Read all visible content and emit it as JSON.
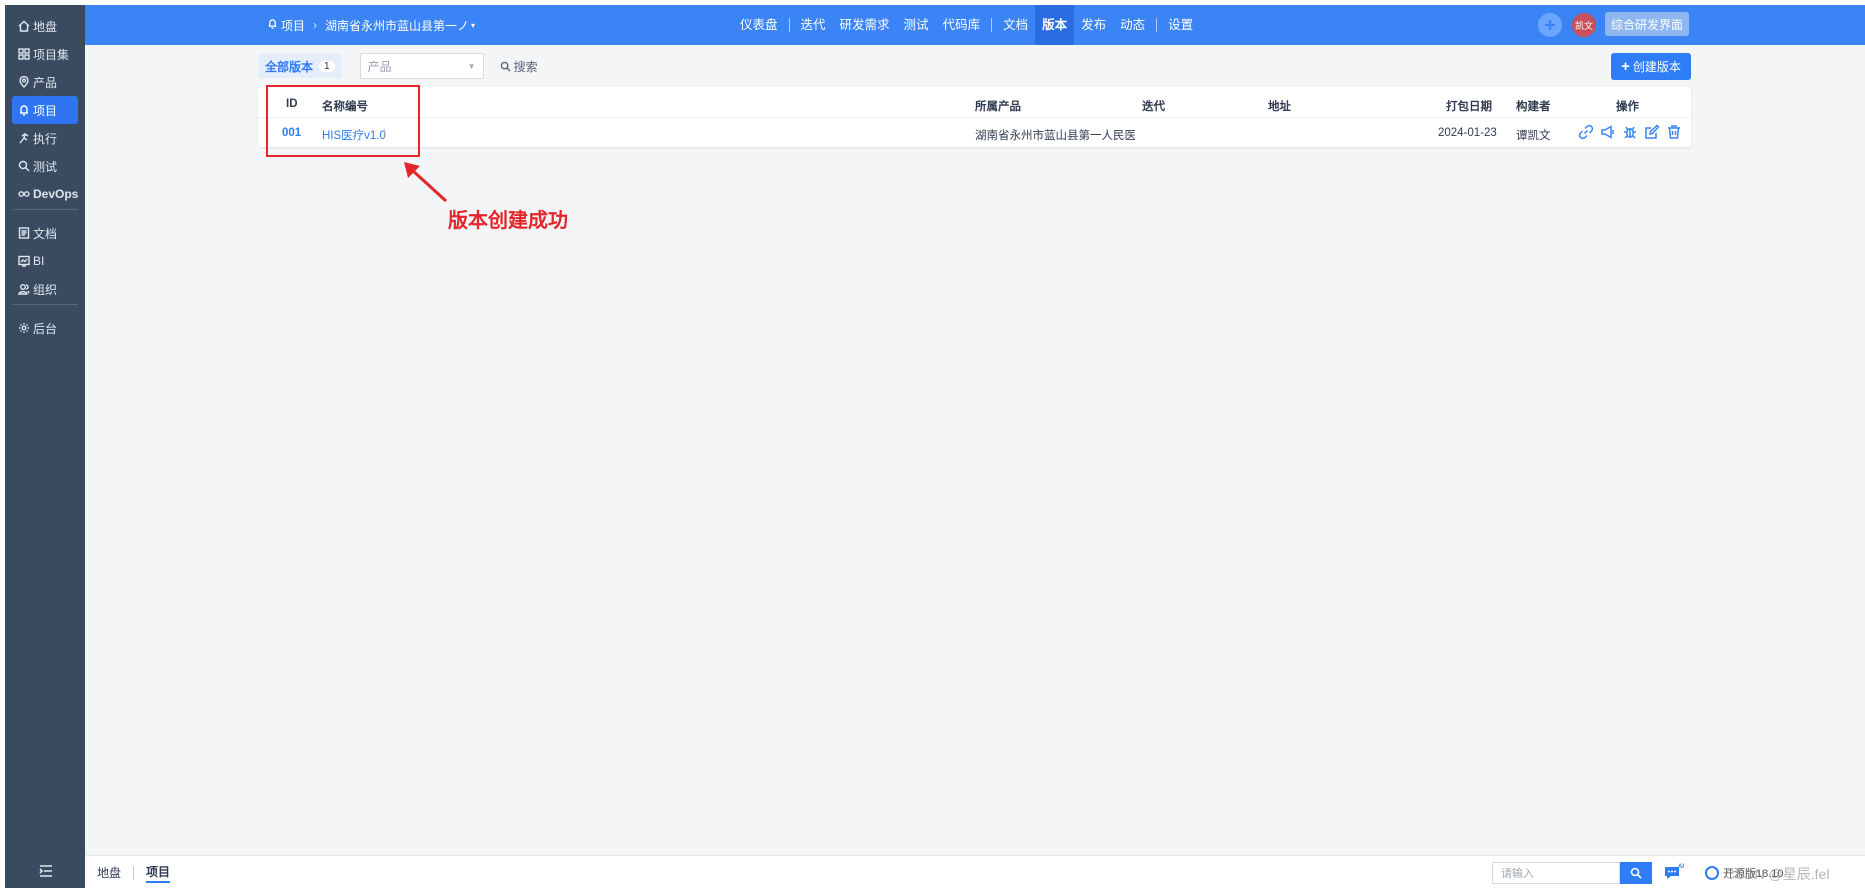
{
  "sidebar": {
    "items": [
      {
        "label": "地盘",
        "icon": "home-icon"
      },
      {
        "label": "项目集",
        "icon": "grid-icon"
      },
      {
        "label": "产品",
        "icon": "location-icon"
      },
      {
        "label": "项目",
        "icon": "bell-icon",
        "active": true
      },
      {
        "label": "执行",
        "icon": "run-icon"
      },
      {
        "label": "测试",
        "icon": "search-icon"
      },
      {
        "label": "DevOps",
        "icon": "infinity-icon"
      },
      {
        "label": "文档",
        "icon": "document-icon"
      },
      {
        "label": "BI",
        "icon": "chart-icon"
      },
      {
        "label": "组织",
        "icon": "users-icon"
      },
      {
        "label": "后台",
        "icon": "gear-icon"
      }
    ]
  },
  "topbar": {
    "breadcrumb_root": "项目",
    "breadcrumb_project": "湖南省永州市蓝山县第一ノ",
    "nav": [
      "仪表盘",
      "迭代",
      "研发需求",
      "测试",
      "代码库",
      "文档",
      "版本",
      "发布",
      "动态",
      "设置"
    ],
    "active_nav": "版本",
    "avatar_text": "凯文",
    "ui_switch_label": "综合研发界面",
    "brand_color": "#3a84f5"
  },
  "toolbar": {
    "tab_all_label": "全部版本",
    "tab_all_count": "1",
    "product_placeholder": "产品",
    "search_label": "搜索",
    "create_label": "创建版本"
  },
  "table": {
    "headers": {
      "id": "ID",
      "name": "名称编号",
      "product": "所属产品",
      "iteration": "迭代",
      "address": "地址",
      "date": "打包日期",
      "builder": "构建者",
      "actions": "操作"
    },
    "rows": [
      {
        "id": "001",
        "name": "HIS医疗v1.0",
        "product": "湖南省永州市蓝山县第一人民医院",
        "iteration": "",
        "address": "",
        "date": "2024-01-23",
        "builder": "谭凯文"
      }
    ],
    "action_icons": [
      "link-icon",
      "megaphone-icon",
      "bug-icon",
      "edit-icon",
      "trash-icon"
    ]
  },
  "annotation": {
    "text": "版本创建成功",
    "color": "#e3262b"
  },
  "footer": {
    "crumb_home": "地盘",
    "crumb_current": "项目",
    "search_placeholder": "请输入",
    "version_text": "开源版18.10",
    "watermark": "CSDN @星辰.fel"
  }
}
